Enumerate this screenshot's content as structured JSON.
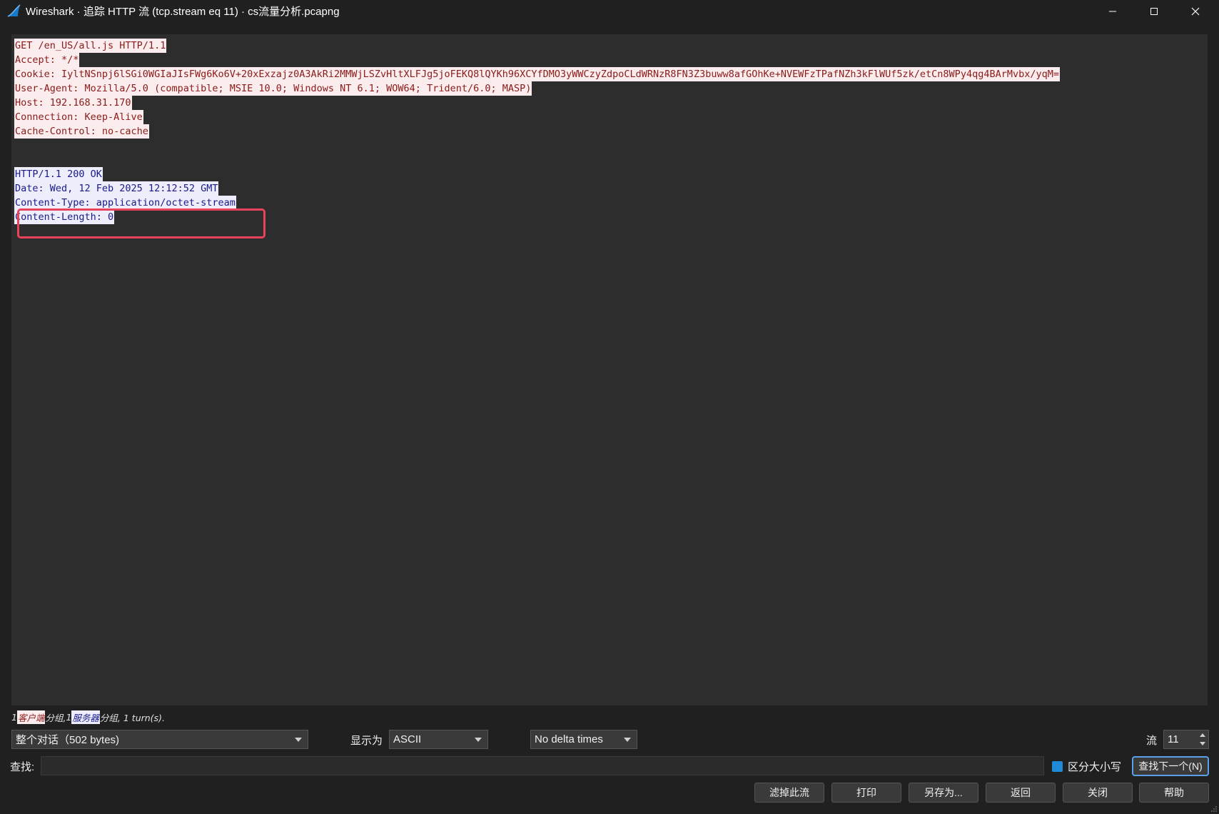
{
  "window": {
    "title": "Wireshark · 追踪 HTTP 流 (tcp.stream eq 11) · cs流量分析.pcapng",
    "icon": "wireshark-fin-icon"
  },
  "stream": {
    "client_lines": [
      "GET /en_US/all.js HTTP/1.1",
      "Accept: */*",
      "Cookie: IyltNSnpj6lSGi0WGIaJIsFWg6Ko6V+20xExzajz0A3AkRi2MMWjLSZvHltXLFJg5joFEKQ8lQYKh96XCYfDMO3yWWCzyZdpoCLdWRNzR8FN3Z3buww8afGOhKe+NVEWFzTPafNZh3kFlWUf5zk/etCn8WPy4qg4BArMvbx/yqM=",
      "User-Agent: Mozilla/5.0 (compatible; MSIE 10.0; Windows NT 6.1; WOW64; Trident/6.0; MASP)",
      "Host: 192.168.31.170",
      "Connection: Keep-Alive",
      "Cache-Control: no-cache"
    ],
    "server_lines": [
      "HTTP/1.1 200 OK",
      "Date: Wed, 12 Feb 2025 12:12:52 GMT",
      "Content-Type: application/octet-stream",
      "Content-Length: 0"
    ],
    "client_color": "#8b1a1a",
    "server_color": "#1a1a8b",
    "highlight_color": "#e8435a"
  },
  "stats": {
    "client_count": "1",
    "client_label": "客户端",
    "client_suffix": " 分组, ",
    "server_count": "1",
    "server_label": "服务器",
    "server_suffix": " 分组, 1 turn(s)."
  },
  "controls": {
    "conversation": "整个对话（502 bytes)",
    "show_as_label": "显示为",
    "show_as_value": "ASCII",
    "delta": "No delta times",
    "stream_label": "流",
    "stream_value": "11"
  },
  "search": {
    "label": "查找:",
    "value": "",
    "case_label": "区分大小写",
    "case_checked": true,
    "find_next": "查找下一个(N)"
  },
  "buttons": {
    "filter_out": "滤掉此流",
    "print": "打印",
    "save_as": "另存为...",
    "back": "返回",
    "close": "关闭",
    "help": "帮助"
  }
}
